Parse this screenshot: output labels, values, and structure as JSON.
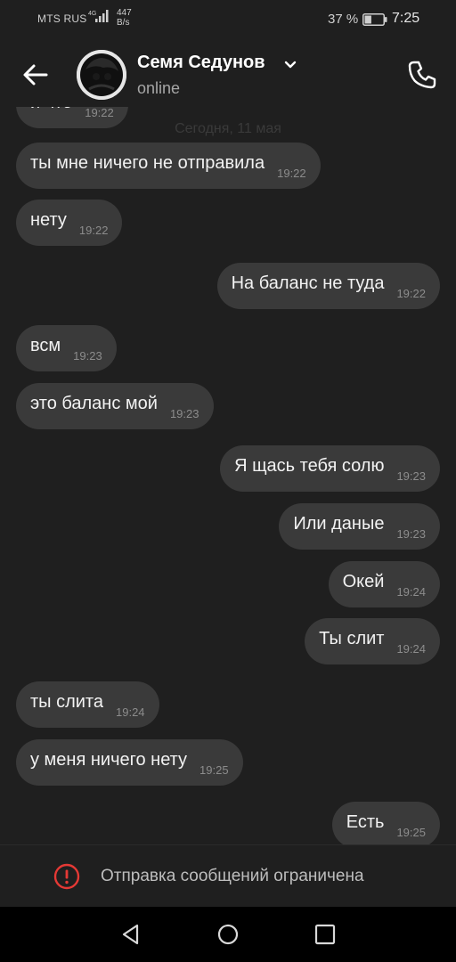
{
  "status_bar": {
    "carrier": "MTS RUS",
    "network_type": "4G",
    "speed_value": "447",
    "speed_unit": "B/s",
    "battery_percent": "37 %",
    "battery_level": 0.37,
    "time": "7:25"
  },
  "header": {
    "contact_name": "Семя Седунов",
    "contact_status": "online",
    "icons": {
      "back": "arrow-left-icon",
      "dropdown": "chevron-down-icon",
      "call": "phone-icon"
    }
  },
  "chat": {
    "date_separator": "Сегодня, 11 мая",
    "messages": [
      {
        "direction": "in",
        "text": "и что",
        "time": "19:22"
      },
      {
        "direction": "in",
        "text": "ты мне ничего не отправила",
        "time": "19:22"
      },
      {
        "direction": "in",
        "text": "нету",
        "time": "19:22"
      },
      {
        "direction": "out",
        "text": "На баланс не туда",
        "time": "19:22"
      },
      {
        "direction": "in",
        "text": "всм",
        "time": "19:23"
      },
      {
        "direction": "in",
        "text": "это баланс мой",
        "time": "19:23"
      },
      {
        "direction": "out",
        "text": "Я щась тебя солю",
        "time": "19:23"
      },
      {
        "direction": "out",
        "text": "Или даные",
        "time": "19:23"
      },
      {
        "direction": "out",
        "text": "Окей",
        "time": "19:24"
      },
      {
        "direction": "out",
        "text": "Ты слит",
        "time": "19:24"
      },
      {
        "direction": "in",
        "text": "ты слита",
        "time": "19:24"
      },
      {
        "direction": "in",
        "text": "у меня ничего нету",
        "time": "19:25"
      },
      {
        "direction": "out",
        "text": "Есть",
        "time": "19:25"
      }
    ]
  },
  "restriction": {
    "text": "Отправка сообщений ограничена",
    "icon": "alert-circle-icon",
    "color": "#e53935"
  },
  "nav_bar": {
    "icons": [
      "triangle-back-icon",
      "circle-home-icon",
      "square-recents-icon"
    ]
  }
}
